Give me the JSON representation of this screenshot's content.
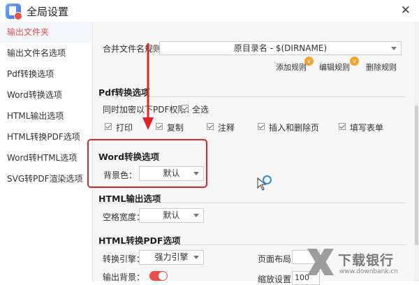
{
  "window": {
    "title": "全局设置",
    "close_glyph": "✕"
  },
  "sidebar": {
    "items": [
      {
        "label": "输出文件夹",
        "active": true
      },
      {
        "label": "输出文件名选项"
      },
      {
        "label": "Pdf转换选项"
      },
      {
        "label": "Word转换选项"
      },
      {
        "label": "HTML输出选项"
      },
      {
        "label": "HTML转换PDF选项"
      },
      {
        "label": "Word转HTML选项"
      },
      {
        "label": "SVG转PDF渲染选项"
      }
    ]
  },
  "filename": {
    "merge_rule_label": "合并文件名规则：",
    "merge_rule_value": "原目录名 - $(DIRNAME)",
    "add_rule": "添加规则",
    "edit_rule": "编辑规则",
    "delete_rule": "删除规则",
    "badge_glyph": "v"
  },
  "pdf": {
    "section_title": "Pdf转换选项",
    "encrypt_label": "同时加密以下PDF权限：",
    "select_all": "全选",
    "permissions": [
      "打印",
      "复制",
      "注释",
      "插入和删除页",
      "填写表单"
    ]
  },
  "word": {
    "section_title": "Word转换选项",
    "bg_label": "背景色：",
    "bg_value": "默认"
  },
  "html_out": {
    "section_title": "HTML输出选项",
    "space_label": "空格宽度：",
    "space_value": "默认"
  },
  "html_pdf": {
    "section_title": "HTML转换PDF选项",
    "engine_label": "转换引擎：",
    "engine_value": "强力引擎",
    "layout_label": "页面布局：",
    "output_bg_label": "输出背景：",
    "output_bg_on": true,
    "zoom_label": "缩放设置：",
    "zoom_value": "100"
  },
  "watermark": {
    "name": "下载银行",
    "url": "www.downbank.cn"
  },
  "colors": {
    "accent_red": "#e0524b",
    "highlight_red": "#e0242a",
    "toggle_red": "#e8504a",
    "badge_orange": "#f2a42c"
  }
}
